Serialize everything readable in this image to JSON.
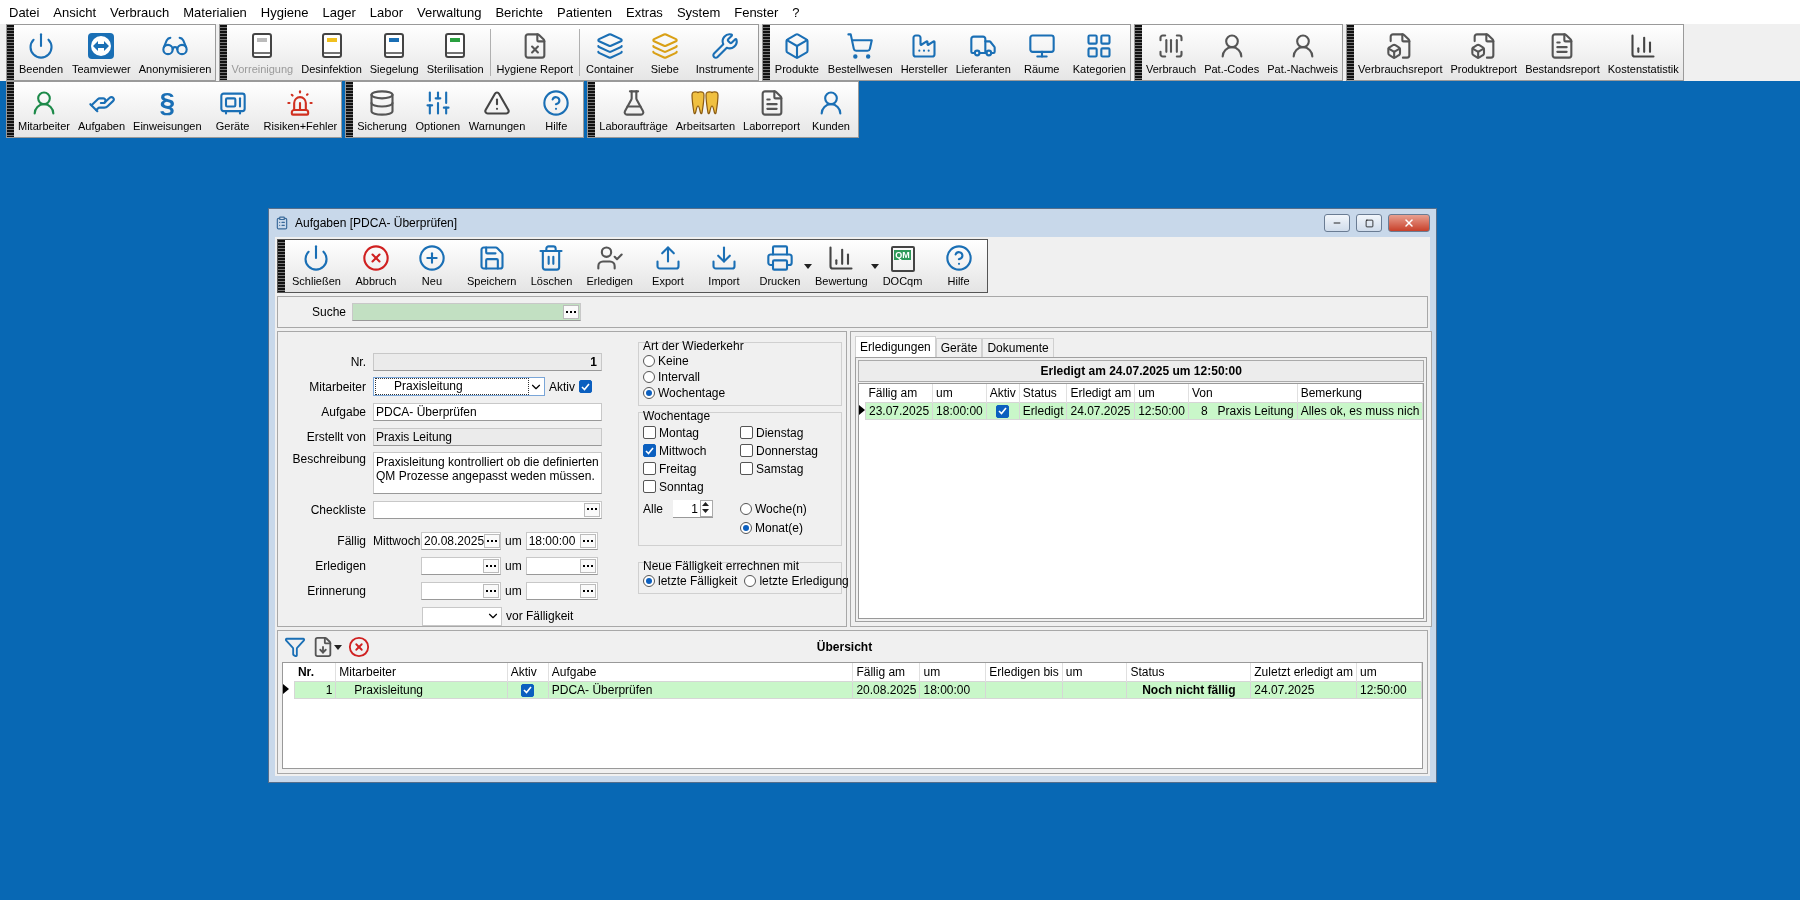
{
  "menu": [
    "Datei",
    "Ansicht",
    "Verbrauch",
    "Materialien",
    "Hygiene",
    "Lager",
    "Labor",
    "Verwaltung",
    "Berichte",
    "Patienten",
    "Extras",
    "System",
    "Fenster",
    "?"
  ],
  "toolbar_rows": [
    {
      "groups": [
        {
          "sections": [
            [
              {
                "label": "Beenden",
                "disabled": false
              },
              {
                "label": "Teamviewer",
                "disabled": false
              },
              {
                "label": "Anonymisieren",
                "disabled": false
              }
            ]
          ]
        },
        {
          "sections": [
            [
              {
                "label": "Vorreinigung",
                "disabled": true
              },
              {
                "label": "Desinfektion",
                "disabled": false
              },
              {
                "label": "Siegelung",
                "disabled": false
              },
              {
                "label": "Sterilisation",
                "disabled": false
              }
            ],
            [
              {
                "label": "Hygiene Report",
                "disabled": false
              }
            ],
            [
              {
                "label": "Container",
                "disabled": false
              },
              {
                "label": "Siebe",
                "disabled": false
              },
              {
                "label": "Instrumente",
                "disabled": false
              }
            ]
          ]
        },
        {
          "sections": [
            [
              {
                "label": "Produkte",
                "disabled": false
              },
              {
                "label": "Bestellwesen",
                "disabled": false
              },
              {
                "label": "Hersteller",
                "disabled": false
              },
              {
                "label": "Lieferanten",
                "disabled": false
              },
              {
                "label": "Räume",
                "disabled": false
              },
              {
                "label": "Kategorien",
                "disabled": false
              }
            ]
          ]
        },
        {
          "sections": [
            [
              {
                "label": "Verbrauch",
                "disabled": false
              },
              {
                "label": "Pat.-Codes",
                "disabled": false
              },
              {
                "label": "Pat.-Nachweis",
                "disabled": false
              }
            ]
          ]
        },
        {
          "sections": [
            [
              {
                "label": "Verbrauchsreport",
                "disabled": false
              },
              {
                "label": "Produktreport",
                "disabled": false
              },
              {
                "label": "Bestandsreport",
                "disabled": false
              },
              {
                "label": "Kostenstatistik",
                "disabled": false
              }
            ]
          ]
        }
      ]
    },
    {
      "groups": [
        {
          "sections": [
            [
              {
                "label": "Mitarbeiter",
                "disabled": false
              },
              {
                "label": "Aufgaben",
                "disabled": false
              },
              {
                "label": "Einweisungen",
                "disabled": false,
                "glyph": "§"
              },
              {
                "label": "Geräte",
                "disabled": false
              },
              {
                "label": "Risiken+Fehler",
                "disabled": false
              }
            ]
          ]
        },
        {
          "sections": [
            [
              {
                "label": "Sicherung",
                "disabled": false
              },
              {
                "label": "Optionen",
                "disabled": false
              },
              {
                "label": "Warnungen",
                "disabled": false
              },
              {
                "label": "Hilfe",
                "disabled": false
              }
            ]
          ]
        },
        {
          "sections": [
            [
              {
                "label": "Laboraufträge",
                "disabled": false
              },
              {
                "label": "Arbeitsarten",
                "disabled": false
              },
              {
                "label": "Laborreport",
                "disabled": false
              },
              {
                "label": "Kunden",
                "disabled": false
              }
            ]
          ]
        }
      ]
    }
  ],
  "window": {
    "title": "Aufgaben [PDCA- Überprüfen]",
    "toolbar": [
      {
        "label": "Schließen",
        "has_menu": false
      },
      {
        "label": "Abbruch",
        "has_menu": false
      },
      {
        "label": "Neu",
        "has_menu": false
      },
      {
        "label": "Speichern",
        "has_menu": false
      },
      {
        "label": "Löschen",
        "has_menu": false
      },
      {
        "label": "Erledigen",
        "has_menu": false
      },
      {
        "label": "Export",
        "has_menu": false
      },
      {
        "label": "Import",
        "has_menu": false
      },
      {
        "label": "Drucken",
        "has_menu": true
      },
      {
        "label": "Bewertung",
        "has_menu": true
      },
      {
        "label": "DOCqm",
        "has_menu": false,
        "glyph": "QM"
      },
      {
        "label": "Hilfe",
        "has_menu": false
      }
    ],
    "search": {
      "label": "Suche"
    },
    "form": {
      "nr": {
        "label": "Nr.",
        "value": "1"
      },
      "mitarbeiter": {
        "label": "Mitarbeiter",
        "value": "Praxisleitung"
      },
      "aktiv": {
        "label": "Aktiv",
        "checked": true
      },
      "aufgabe": {
        "label": "Aufgabe",
        "value": "PDCA- Überprüfen"
      },
      "erstellt_von": {
        "label": "Erstellt von",
        "value": "Praxis Leitung"
      },
      "beschreibung": {
        "label": "Beschreibung",
        "value": "Praxisleitung kontrolliert ob die definierten QM Prozesse angepasst weden müssen."
      },
      "checkliste": {
        "label": "Checkliste"
      },
      "faellig": {
        "label": "Fällig",
        "weekday": "Mittwoch",
        "date": "20.08.2025",
        "at": "um",
        "time": "18:00:00"
      },
      "erledigen": {
        "label": "Erledigen",
        "at": "um"
      },
      "erinnerung": {
        "label": "Erinnerung",
        "at": "um"
      },
      "vor_faelligkeit": {
        "label": "vor Fälligkeit"
      }
    },
    "recurrence": {
      "title": "Art der Wiederkehr",
      "options": [
        {
          "label": "Keine",
          "selected": false
        },
        {
          "label": "Intervall",
          "selected": false
        },
        {
          "label": "Wochentage",
          "selected": true
        }
      ]
    },
    "weekdays": {
      "title": "Wochentage",
      "days": [
        {
          "label": "Montag",
          "checked": false
        },
        {
          "label": "Dienstag",
          "checked": false
        },
        {
          "label": "Mittwoch",
          "checked": true
        },
        {
          "label": "Donnerstag",
          "checked": false
        },
        {
          "label": "Freitag",
          "checked": false
        },
        {
          "label": "Samstag",
          "checked": false
        },
        {
          "label": "Sonntag",
          "checked": false
        }
      ],
      "every": {
        "label": "Alle",
        "value": "1"
      },
      "units": [
        {
          "label": "Woche(n)",
          "selected": false
        },
        {
          "label": "Monat(e)",
          "selected": true
        }
      ]
    },
    "recalc": {
      "title": "Neue Fälligkeit errechnen mit",
      "options": [
        {
          "label": "letzte Fälligkeit",
          "selected": true
        },
        {
          "label": "letzte Erledigung",
          "selected": false
        }
      ]
    },
    "tabs": [
      {
        "label": "Erledigungen",
        "selected": true
      },
      {
        "label": "Geräte",
        "selected": false
      },
      {
        "label": "Dokumente",
        "selected": false
      }
    ],
    "completions": {
      "caption": "Erledigt am 24.07.2025 um 12:50:00",
      "columns": [
        "Fällig am",
        "um",
        "Aktiv",
        "Status",
        "Erledigt am",
        "um",
        "Von",
        "Bemerkung"
      ],
      "rows": [
        {
          "current": true,
          "cells": [
            {
              "kind": "text",
              "text": "23.07.2025"
            },
            {
              "kind": "text",
              "text": "18:00:00"
            },
            {
              "kind": "check",
              "checked": true
            },
            {
              "kind": "text",
              "text": "Erledigt"
            },
            {
              "kind": "text",
              "text": "24.07.2025"
            },
            {
              "kind": "text",
              "text": "12:50:00"
            },
            {
              "kind": "person",
              "number": "8",
              "text": "Praxis Leitung"
            },
            {
              "kind": "text",
              "text": "Alles ok, es muss nich"
            }
          ]
        }
      ]
    },
    "overview": {
      "title": "Übersicht",
      "columns": [
        "Nr.",
        "Mitarbeiter",
        "Aktiv",
        "Aufgabe",
        "Fällig am",
        "um",
        "Erledigen bis",
        "um",
        "Status",
        "Zuletzt erledigt am",
        "um"
      ],
      "rows": [
        {
          "current": true,
          "cells": [
            {
              "kind": "number",
              "text": "1"
            },
            {
              "kind": "indented",
              "text": "Praxisleitung"
            },
            {
              "kind": "check",
              "checked": true
            },
            {
              "kind": "text",
              "text": "PDCA- Überprüfen"
            },
            {
              "kind": "text",
              "text": "20.08.2025"
            },
            {
              "kind": "text",
              "text": "18:00:00"
            },
            {
              "kind": "empty"
            },
            {
              "kind": "empty"
            },
            {
              "kind": "status",
              "text": "Noch nicht fällig"
            },
            {
              "kind": "text",
              "text": "24.07.2025"
            },
            {
              "kind": "text",
              "text": "12:50:00"
            }
          ]
        }
      ]
    }
  }
}
